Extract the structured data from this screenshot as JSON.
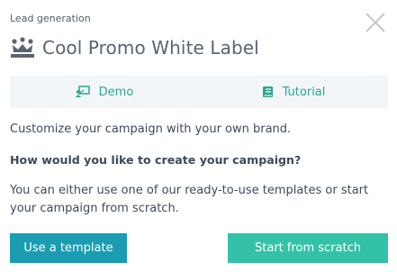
{
  "dialog": {
    "category": "Lead generation",
    "title": "Cool Promo White Label",
    "title_icon": "crown-icon",
    "close_icon": "close-icon"
  },
  "tabs": [
    {
      "label": "Demo",
      "icon": "demo-icon"
    },
    {
      "label": "Tutorial",
      "icon": "book-icon"
    }
  ],
  "body": {
    "intro": "Customize your campaign with your own brand.",
    "question": "How would you like to create your campaign?",
    "description": "You can either use one of our ready-to-use templates or start your campaign from scratch."
  },
  "actions": {
    "template_label": "Use a template",
    "scratch_label": "Start from scratch"
  },
  "colors": {
    "accent": "#2aa68f",
    "template_button": "#1a9db2",
    "scratch_button": "#33c2a8",
    "tab_background": "#f3f6f8"
  }
}
